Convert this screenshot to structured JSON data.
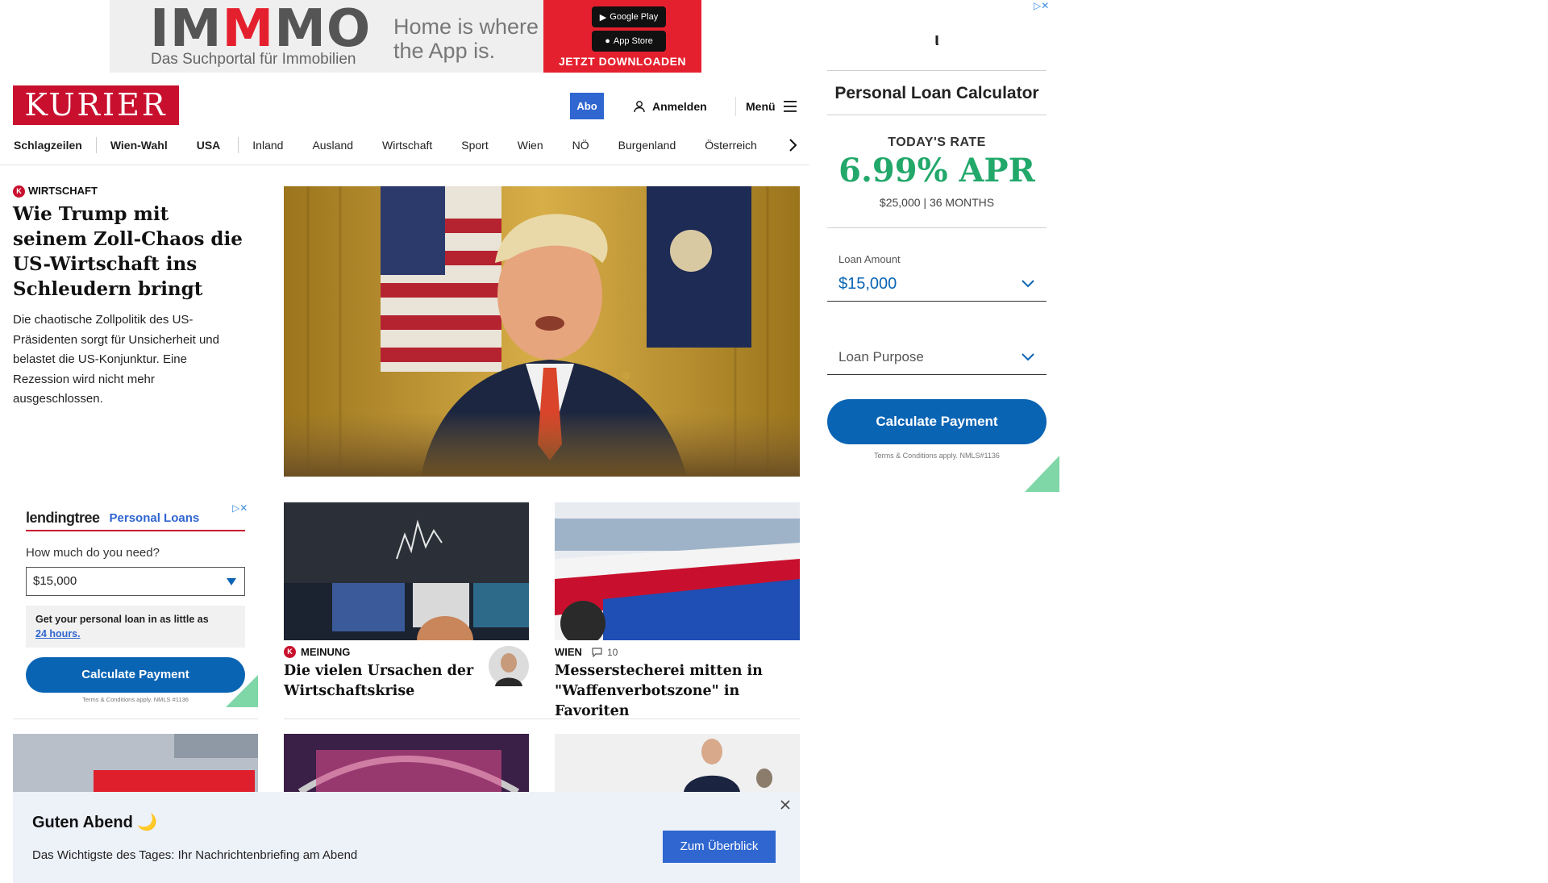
{
  "top_ad": {
    "brand_a": "IM",
    "brand_b": "M",
    "brand_c": "MO",
    "tagline": "Das Suchportal für Immobilien",
    "slogan_line1": "Home is where",
    "slogan_line2": "the App is.",
    "google_play": "Google Play",
    "app_store": "App Store",
    "cta": "JETZT DOWNLOADEN"
  },
  "header": {
    "logo": "KURIER",
    "abo": "Abo",
    "login": "Anmelden",
    "menu": "Menü"
  },
  "nav": {
    "items": [
      "Schlagzeilen",
      "Wien-Wahl",
      "USA",
      "Inland",
      "Ausland",
      "Wirtschaft",
      "Sport",
      "Wien",
      "NÖ",
      "Burgenland",
      "Österreich"
    ]
  },
  "lead": {
    "badge": "K",
    "kicker": "Wirtschaft",
    "title": "Wie Trump mit seinem Zoll-Chaos die US-Wirtschaft ins Schleudern bringt",
    "teaser": "Die chaotische Zollpolitik des US-Präsidenten sorgt für Unsicherheit und belastet die US-Konjunktur. Eine Rezession wird nicht mehr ausgeschlossen."
  },
  "left_ad": {
    "brand": "lendingtree",
    "product": "Personal Loans",
    "question": "How much do you need?",
    "amount": "$15,000",
    "note": "Get your personal loan in as little as",
    "note_link": "24 hours.",
    "button": "Calculate Payment",
    "terms": "Terms & Conditions apply. NMLS #1136"
  },
  "cards": [
    {
      "badge": "K",
      "kicker": "Meinung",
      "title": "Die vielen Ursachen der Wirtschaftskrise"
    },
    {
      "kicker": "Wien",
      "comments": "10",
      "title": "Messerstecherei mitten in \"Waffenverbotszone\" in Favoriten"
    }
  ],
  "right_ad": {
    "logo_glyph": "ι",
    "heading": "Personal Loan Calculator",
    "rate_label": "TODAY'S RATE",
    "rate": "6.99% APR",
    "rate_sub": "$25,000 | 36 MONTHS",
    "loan_amount_label": "Loan Amount",
    "loan_amount": "$15,000",
    "loan_purpose": "Loan Purpose",
    "button": "Calculate Payment",
    "terms": "Terms & Conditions apply. NMLS#1136"
  },
  "briefing": {
    "title": "Guten Abend 🌙",
    "subtitle": "Das Wichtigste des Tages: Ihr Nachrichtenbriefing am Abend",
    "button": "Zum Überblick"
  },
  "colors": {
    "kurier_red": "#c8102e",
    "accent_blue": "#2f66d0",
    "ad_blue": "#0a64b4",
    "rate_green": "#22a86a"
  }
}
